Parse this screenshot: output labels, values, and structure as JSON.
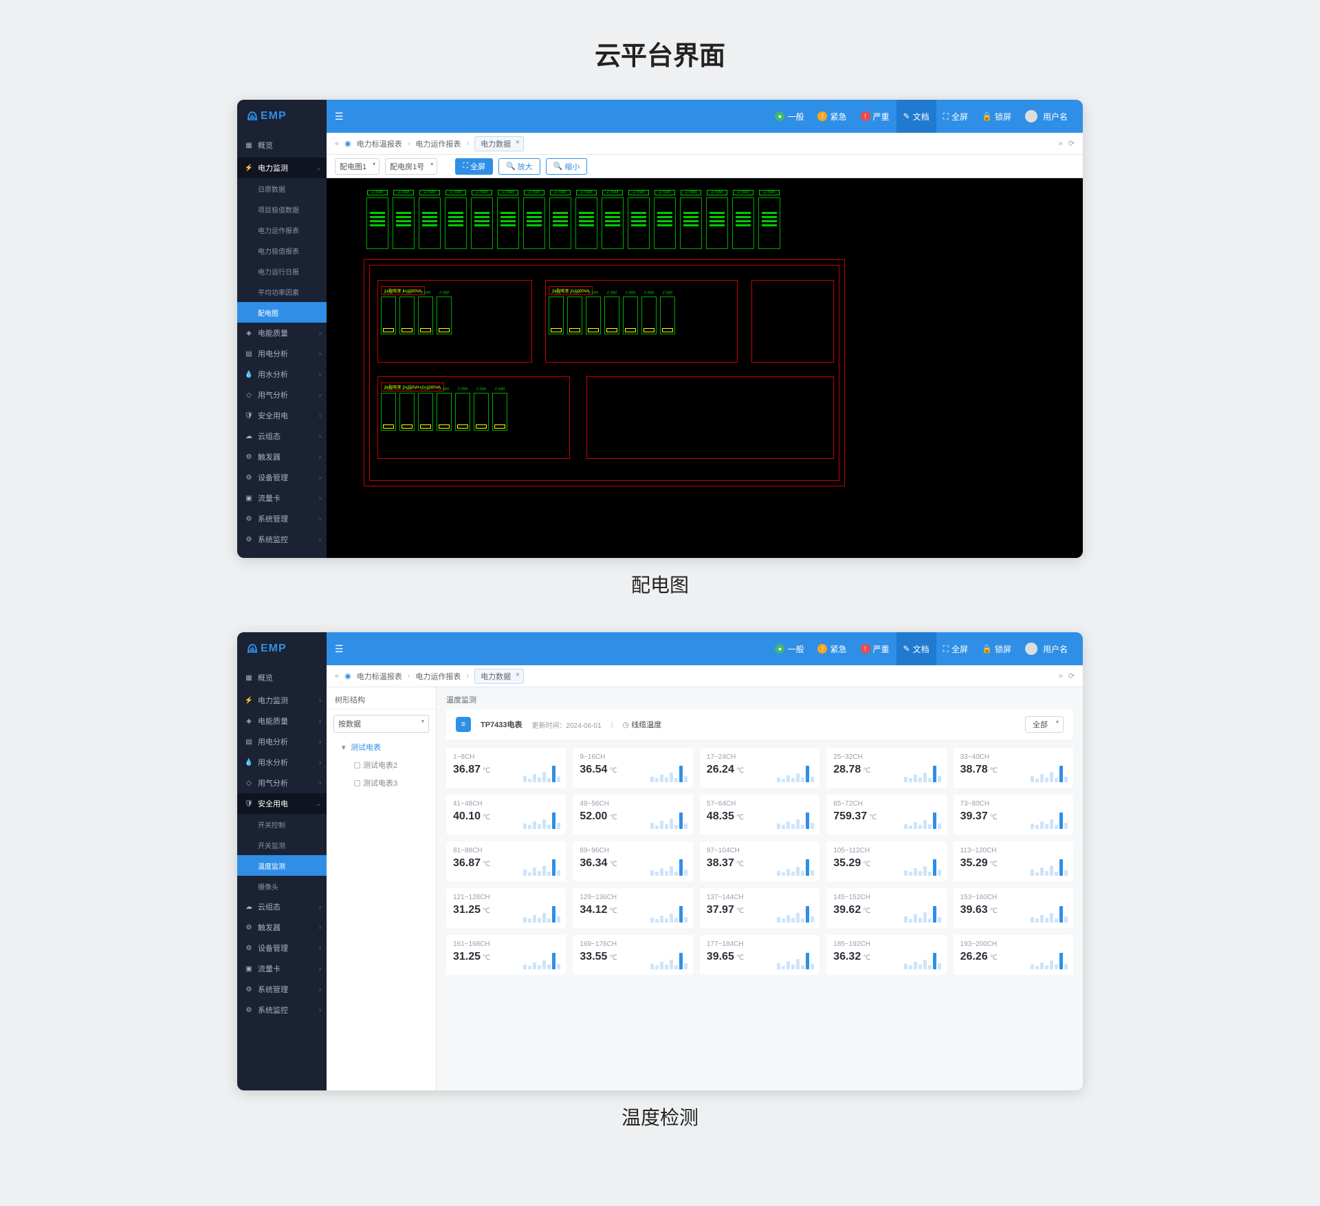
{
  "page_title": "云平台界面",
  "caption1": "配电图",
  "caption2": "温度检测",
  "app": {
    "logo": "EMP",
    "topbar": {
      "status": [
        {
          "label": "一般",
          "dot": "g",
          "glyph": "●"
        },
        {
          "label": "紧急",
          "dot": "o",
          "glyph": "!"
        },
        {
          "label": "严重",
          "dot": "r",
          "glyph": "!"
        }
      ],
      "actions": [
        {
          "name": "doc",
          "label": "文档",
          "glyph": "✎",
          "active": true
        },
        {
          "name": "fullscreen",
          "label": "全屏",
          "glyph": "⛶"
        },
        {
          "name": "lock",
          "label": "锁屏",
          "glyph": "🔒"
        }
      ],
      "user": "用户名"
    },
    "breadcrumb": {
      "left_chev": "«",
      "bullet": "◉",
      "items": [
        "电力标温报表",
        "电力运作报表"
      ],
      "tab": "电力数据",
      "right_chev": "»",
      "refresh": "⟳"
    }
  },
  "screen1": {
    "sidebar": [
      {
        "icon": "▦",
        "label": "概览",
        "top": true
      },
      {
        "icon": "⚡",
        "label": "电力监测",
        "expanded": true,
        "children": [
          {
            "label": "日原数据"
          },
          {
            "label": "项目极值数据"
          },
          {
            "label": "电力运作报表"
          },
          {
            "label": "电力极值报表"
          },
          {
            "label": "电力运行日报"
          },
          {
            "label": "平均功率因素"
          },
          {
            "label": "配电图",
            "selected": true
          }
        ]
      },
      {
        "icon": "◈",
        "label": "电能质量"
      },
      {
        "icon": "▤",
        "label": "用电分析"
      },
      {
        "icon": "💧",
        "label": "用水分析"
      },
      {
        "icon": "◇",
        "label": "用气分析"
      },
      {
        "icon": "🛡",
        "label": "安全用电"
      },
      {
        "icon": "☁",
        "label": "云组态"
      },
      {
        "icon": "⚙",
        "label": "触发器"
      },
      {
        "icon": "⚙",
        "label": "设备管理"
      },
      {
        "icon": "▣",
        "label": "流量卡"
      },
      {
        "icon": "⚙",
        "label": "系统管理"
      },
      {
        "icon": "⚙",
        "label": "系统监控"
      }
    ],
    "toolbar": {
      "sel1": "配电图1",
      "sel2": "配电房1号",
      "btn_full": "全屏",
      "btn_zoomin": "放大",
      "btn_zoomout": "缩小"
    },
    "diagram": {
      "top_slots_count": 16,
      "slot_label": "Z-SWI",
      "group1": "1#配电室 4×1000VA",
      "group2": "2#配电室 2×1000VA",
      "group3": "3#配电室 2×250VA+2×1000VA"
    }
  },
  "screen2": {
    "sidebar": [
      {
        "icon": "▦",
        "label": "概览",
        "top": true
      },
      {
        "icon": "⚡",
        "label": "电力监测"
      },
      {
        "icon": "◈",
        "label": "电能质量"
      },
      {
        "icon": "▤",
        "label": "用电分析"
      },
      {
        "icon": "💧",
        "label": "用水分析"
      },
      {
        "icon": "◇",
        "label": "用气分析"
      },
      {
        "icon": "🛡",
        "label": "安全用电",
        "expanded": true,
        "children": [
          {
            "label": "开关控制"
          },
          {
            "label": "开关监测"
          },
          {
            "label": "温度监测",
            "selected": true
          },
          {
            "label": "摄像头"
          }
        ]
      },
      {
        "icon": "☁",
        "label": "云组态"
      },
      {
        "icon": "⚙",
        "label": "触发器"
      },
      {
        "icon": "⚙",
        "label": "设备管理"
      },
      {
        "icon": "▣",
        "label": "流量卡"
      },
      {
        "icon": "⚙",
        "label": "系统管理"
      },
      {
        "icon": "⚙",
        "label": "系统监控"
      }
    ],
    "tree": {
      "header": "树形结构",
      "selector": "按数据",
      "root": "测试电表",
      "children": [
        "测试电表2",
        "测试电表3"
      ]
    },
    "panel": {
      "header": "温度监测",
      "device": "TP7433电表",
      "update_label": "更新时间：",
      "update_time": "2024-06-01",
      "tab_icon": "◷",
      "tab": "线缆温度",
      "view": "全部"
    },
    "cards": [
      {
        "range": "1~8CH",
        "val": "36.87",
        "unit": "℃",
        "spark": [
          9,
          5,
          12,
          7,
          15,
          6,
          24,
          8
        ]
      },
      {
        "range": "9~16CH",
        "val": "36.54",
        "unit": "℃",
        "spark": [
          8,
          6,
          11,
          7,
          14,
          6,
          24,
          9
        ]
      },
      {
        "range": "17~24CH",
        "val": "26.24",
        "unit": "℃",
        "spark": [
          7,
          5,
          10,
          6,
          13,
          7,
          24,
          8
        ]
      },
      {
        "range": "25~32CH",
        "val": "28.78",
        "unit": "℃",
        "spark": [
          8,
          6,
          11,
          7,
          14,
          6,
          24,
          9
        ]
      },
      {
        "range": "33~40CH",
        "val": "38.78",
        "unit": "℃",
        "spark": [
          9,
          5,
          12,
          7,
          15,
          6,
          24,
          8
        ]
      },
      {
        "range": "41~48CH",
        "val": "40.10",
        "unit": "℃",
        "spark": [
          8,
          6,
          11,
          7,
          14,
          6,
          24,
          9
        ]
      },
      {
        "range": "49~56CH",
        "val": "52.00",
        "unit": "℃",
        "spark": [
          9,
          5,
          12,
          7,
          15,
          6,
          24,
          8
        ]
      },
      {
        "range": "57~64CH",
        "val": "48.35",
        "unit": "℃",
        "spark": [
          8,
          6,
          11,
          7,
          14,
          6,
          24,
          9
        ]
      },
      {
        "range": "65~72CH",
        "val": "759.37",
        "unit": "℃",
        "spark": [
          7,
          5,
          10,
          6,
          13,
          7,
          24,
          8
        ]
      },
      {
        "range": "73~80CH",
        "val": "39.37",
        "unit": "℃",
        "spark": [
          8,
          6,
          11,
          7,
          14,
          6,
          24,
          9
        ]
      },
      {
        "range": "81~88CH",
        "val": "36.87",
        "unit": "℃",
        "spark": [
          9,
          5,
          12,
          7,
          15,
          6,
          24,
          8
        ]
      },
      {
        "range": "89~96CH",
        "val": "36.34",
        "unit": "℃",
        "spark": [
          8,
          6,
          11,
          7,
          14,
          6,
          24,
          9
        ]
      },
      {
        "range": "97~104CH",
        "val": "38.37",
        "unit": "℃",
        "spark": [
          7,
          5,
          10,
          6,
          13,
          7,
          24,
          8
        ]
      },
      {
        "range": "105~112CH",
        "val": "35.29",
        "unit": "℃",
        "spark": [
          8,
          6,
          11,
          7,
          14,
          6,
          24,
          9
        ]
      },
      {
        "range": "113~120CH",
        "val": "35.29",
        "unit": "℃",
        "spark": [
          9,
          5,
          12,
          7,
          15,
          6,
          24,
          8
        ]
      },
      {
        "range": "121~128CH",
        "val": "31.25",
        "unit": "℃",
        "spark": [
          8,
          6,
          11,
          7,
          14,
          6,
          24,
          9
        ]
      },
      {
        "range": "129~136CH",
        "val": "34.12",
        "unit": "℃",
        "spark": [
          7,
          5,
          10,
          6,
          13,
          7,
          24,
          8
        ]
      },
      {
        "range": "137~144CH",
        "val": "37.97",
        "unit": "℃",
        "spark": [
          8,
          6,
          11,
          7,
          14,
          6,
          24,
          9
        ]
      },
      {
        "range": "145~152CH",
        "val": "39.62",
        "unit": "℃",
        "spark": [
          9,
          5,
          12,
          7,
          15,
          6,
          24,
          8
        ]
      },
      {
        "range": "153~160CH",
        "val": "39.63",
        "unit": "℃",
        "spark": [
          8,
          6,
          11,
          7,
          14,
          6,
          24,
          9
        ]
      },
      {
        "range": "161~168CH",
        "val": "31.25",
        "unit": "℃",
        "spark": [
          7,
          5,
          10,
          6,
          13,
          7,
          24,
          8
        ]
      },
      {
        "range": "169~176CH",
        "val": "33.55",
        "unit": "℃",
        "spark": [
          8,
          6,
          11,
          7,
          14,
          6,
          24,
          9
        ]
      },
      {
        "range": "177~184CH",
        "val": "39.65",
        "unit": "℃",
        "spark": [
          9,
          5,
          12,
          7,
          15,
          6,
          24,
          8
        ]
      },
      {
        "range": "185~192CH",
        "val": "36.32",
        "unit": "℃",
        "spark": [
          8,
          6,
          11,
          7,
          14,
          6,
          24,
          9
        ]
      },
      {
        "range": "193~200CH",
        "val": "26.26",
        "unit": "℃",
        "spark": [
          7,
          5,
          10,
          6,
          13,
          7,
          24,
          8
        ]
      }
    ]
  }
}
